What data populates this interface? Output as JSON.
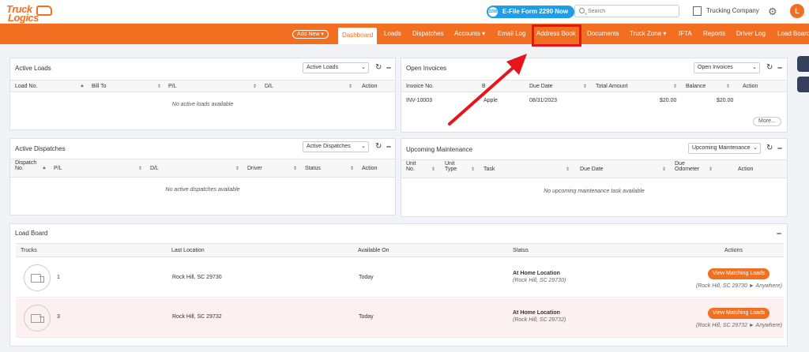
{
  "header": {
    "logo_line1": "Truck",
    "logo_line2": "Logics",
    "efile_badge": "2290",
    "efile_label": "E-File Form 2290 Now",
    "search_placeholder": "Search",
    "company_name": "Trucking Company",
    "avatar_initial": "L"
  },
  "nav": {
    "add_new": "Add New ▾",
    "items": [
      "Dashboard",
      "Loads",
      "Dispatches",
      "Accounts ▾",
      "Email Log",
      "Address Book",
      "Documents",
      "Truck Zone ▾",
      "IFTA",
      "Reports",
      "Driver Log",
      "Load Board"
    ],
    "active": "Dashboard",
    "highlighted": "Address Book"
  },
  "active_loads": {
    "title": "Active Loads",
    "select": "Active Loads",
    "columns": [
      "Load No.",
      "Bill To",
      "P/L",
      "D/L",
      "Action"
    ],
    "empty": "No active loads available"
  },
  "open_invoices": {
    "title": "Open Invoices",
    "select": "Open Invoices",
    "columns": [
      "Invoice No.",
      "B",
      "Due Date",
      "Total Amount",
      "Balance",
      "Action"
    ],
    "rows": [
      {
        "invoice": "INV-10003",
        "bill_to": "Apple",
        "due": "08/31/2023",
        "total": "$20.00",
        "balance": "$20.00"
      }
    ],
    "more": "More..."
  },
  "active_dispatches": {
    "title": "Active Dispatches",
    "select": "Active Dispatches",
    "columns": [
      "Dispatch No.",
      "P/L",
      "D/L",
      "Driver",
      "Status",
      "Action"
    ],
    "empty": "No active dispatches available"
  },
  "maintenance": {
    "title": "Upcoming Maintenance",
    "select": "Upcoming Maintenance",
    "columns": [
      "Unit No.",
      "Unit Type",
      "Task",
      "Due Date",
      "Due Odometer",
      "Action"
    ],
    "empty": "No upcoming maintenance task available"
  },
  "load_board": {
    "title": "Load Board",
    "columns": [
      "Trucks",
      "Last Location",
      "Available On",
      "Status",
      "Actions"
    ],
    "rows": [
      {
        "truck": "1",
        "location": "Rock Hill, SC 29730",
        "available": "Today",
        "status": "At Home Location",
        "status_sub": "(Rock Hill, SC 29730)",
        "button": "View Matching Loads",
        "route": "(Rock Hill, SC 29730 ► Anywhere)"
      },
      {
        "truck": "3",
        "location": "Rock Hill, SC 29732",
        "available": "Today",
        "status": "At Home Location",
        "status_sub": "(Rock Hill, SC 29732)",
        "button": "View Matching Loads",
        "route": "(Rock Hill, SC 29732 ► Anywhere)"
      }
    ]
  },
  "colors": {
    "brand_orange": "#f26f21",
    "annotation_red": "#e8141b",
    "efile_blue": "#1e9ee8",
    "highlight_row": "#fdf0f0"
  }
}
